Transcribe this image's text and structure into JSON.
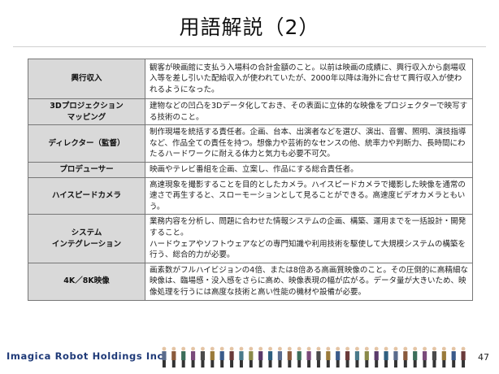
{
  "title": "用語解説（2）",
  "terms": [
    {
      "term": "興行収入",
      "description": "観客が映画館に支払う入場料の合計金額のこと。以前は映画の成績に、興行収入から劇場収入等を差し引いた配給収入が使われていたが、2000年以降は海外に合せて興行収入が使われるようになった。"
    },
    {
      "term": "3Dプロジェクション\nマッピング",
      "description": "建物などの凹凸を3Dデータ化しておき、その表面に立体的な映像をプロジェクターで映写する技術のこと。"
    },
    {
      "term": "ディレクター（監督）",
      "description": "制作現場を統括する責任者。企画、台本、出演者などを選び、演出、音響、照明、演技指導など、作品全ての責任を持つ。想像力や芸術的なセンスの他、統率力や判断力、長時間にわたるハードワークに耐える体力と気力も必要不可欠。"
    },
    {
      "term": "プロデューサー",
      "description": "映画やテレビ番組を企画、立案し、作品にする総合責任者。"
    },
    {
      "term": "ハイスピードカメラ",
      "description": "高速現象を撮影することを目的としたカメラ。ハイスピードカメラで撮影した映像を通常の速さで再生すると、スローモーションとして見ることができる。高速度ビデオカメラともいう。"
    },
    {
      "term": "システム\nインテグレーション",
      "description": "業務内容を分析し、問題に合わせた情報システムの企画、構築、運用までを一括設計・開発すること。\nハードウェアやソフトウェアなどの専門知識や利用技術を駆使して大規模システムの構築を行う、総合的力が必要。"
    },
    {
      "term": "4K／8K映像",
      "description": "画素数がフルハイビジョンの4倍、または8倍ある高画質映像のこと。その圧倒的に高精細な映像は、臨場感・没入感をさらに高め、映像表現の幅が広がる。データ量が大きいため、映像処理を行うには高度な技術と高い性能の機材や設備が必要。"
    }
  ],
  "footer": {
    "company": "Imagica Robot Holdings Inc.",
    "page_number": "47"
  }
}
